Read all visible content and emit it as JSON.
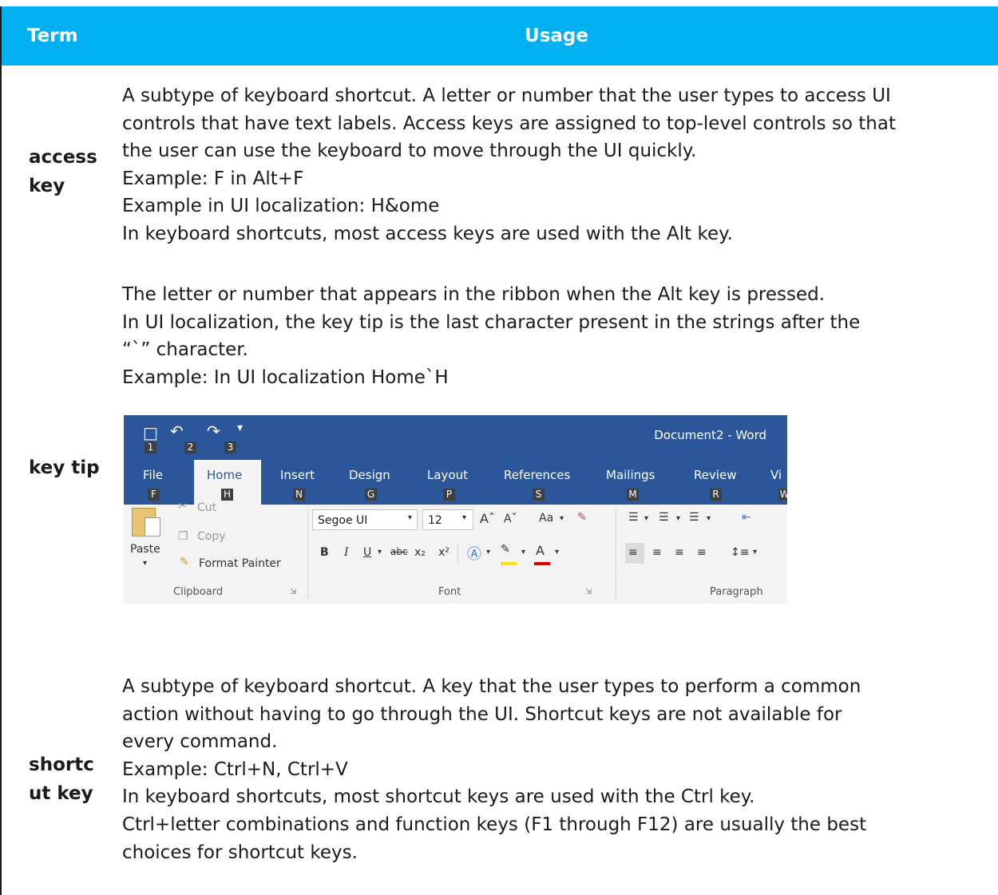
{
  "header": {
    "term": "Term",
    "usage": "Usage"
  },
  "rows": [
    {
      "term": [
        "access",
        "key"
      ],
      "usage": [
        "A subtype of keyboard shortcut. A letter or number that the user types to access UI",
        "controls that have text labels. Access keys are assigned to top-level controls so that",
        "the user can use the keyboard to move through the UI quickly.",
        "Example: F in Alt+F",
        "Example in UI localization: H&ome",
        "In keyboard shortcuts, most access keys are used with the Alt key."
      ]
    },
    {
      "term": [
        "key tip"
      ],
      "usage": [
        "The letter or number that appears in the ribbon when the Alt key is pressed.",
        "In UI localization, the key tip is the last character present in the strings after the",
        "“`” character.",
        "Example: In UI localization Home`H"
      ]
    },
    {
      "term": [
        "shortc",
        "ut key"
      ],
      "usage": [
        "A subtype of keyboard shortcut. A key that the user types to perform a common",
        "action without having to go through the UI. Shortcut keys are not available for",
        "every command.",
        "Example: Ctrl+N, Ctrl+V",
        "In keyboard shortcuts, most shortcut keys are used with the Ctrl key.",
        "Ctrl+letter combinations and function keys (F1 through F12) are usually the best",
        "choices for shortcut keys."
      ]
    }
  ],
  "ribbon": {
    "doc_title": "Document2 - Word",
    "qat_keytips": [
      "1",
      "2",
      "3"
    ],
    "tabs": [
      "File",
      "Home",
      "Insert",
      "Design",
      "Layout",
      "References",
      "Mailings",
      "Review",
      "Vi"
    ],
    "tab_keytips": [
      "F",
      "H",
      "N",
      "G",
      "P",
      "S",
      "M",
      "R",
      "W"
    ],
    "clipboard": {
      "cut": "Cut",
      "copy": "Copy",
      "paste": "Paste",
      "format_painter": "Format Painter",
      "group": "Clipboard"
    },
    "font": {
      "name": "Segoe UI",
      "size": "12",
      "change_case": "Aa",
      "group": "Font"
    },
    "paragraph": {
      "group": "Paragraph"
    },
    "colors": {
      "title_bar": "#2b579a",
      "header": "#00b0f0",
      "keytip": "#404040"
    }
  }
}
